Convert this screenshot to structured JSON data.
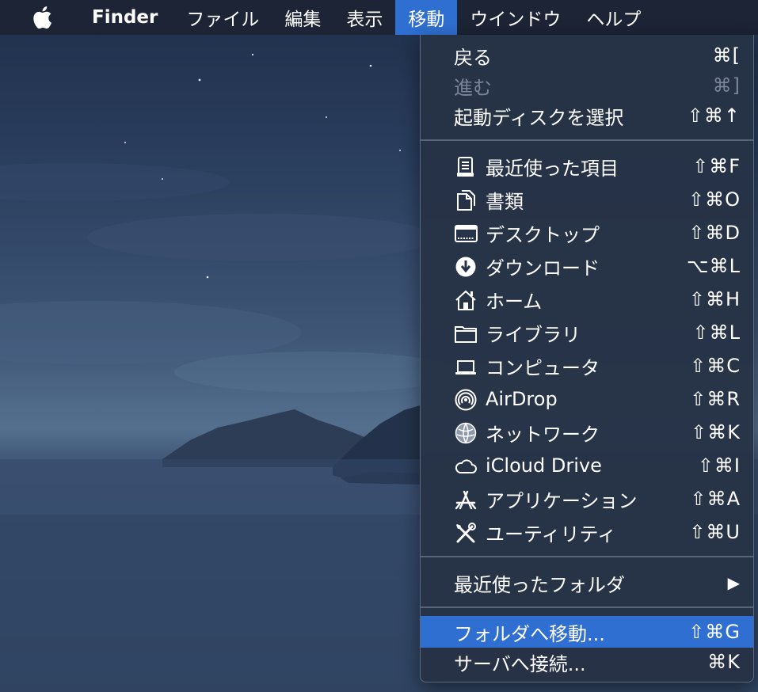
{
  "menubar": {
    "apple_icon": "apple-logo-icon",
    "app_name": "Finder",
    "items": [
      "ファイル",
      "編集",
      "表示",
      "移動",
      "ウインドウ",
      "ヘルプ"
    ],
    "active_item": "移動"
  },
  "go_menu": {
    "back": {
      "label": "戻る",
      "shortcut": "⌘["
    },
    "forward": {
      "label": "進む",
      "shortcut": "⌘]",
      "disabled": true
    },
    "startup_disk": {
      "label": "起動ディスクを選択",
      "shortcut": "⇧⌘↑"
    },
    "locations": [
      {
        "label": "最近使った項目",
        "shortcut": "⇧⌘F",
        "icon": "recents-icon"
      },
      {
        "label": "書類",
        "shortcut": "⇧⌘O",
        "icon": "documents-icon"
      },
      {
        "label": "デスクトップ",
        "shortcut": "⇧⌘D",
        "icon": "desktop-icon"
      },
      {
        "label": "ダウンロード",
        "shortcut": "⌥⌘L",
        "icon": "downloads-icon"
      },
      {
        "label": "ホーム",
        "shortcut": "⇧⌘H",
        "icon": "home-icon"
      },
      {
        "label": "ライブラリ",
        "shortcut": "⇧⌘L",
        "icon": "folder-icon"
      },
      {
        "label": "コンピュータ",
        "shortcut": "⇧⌘C",
        "icon": "computer-icon"
      },
      {
        "label": "AirDrop",
        "shortcut": "⇧⌘R",
        "icon": "airdrop-icon"
      },
      {
        "label": "ネットワーク",
        "shortcut": "⇧⌘K",
        "icon": "network-icon"
      },
      {
        "label": "iCloud Drive",
        "shortcut": "⇧⌘I",
        "icon": "cloud-icon"
      },
      {
        "label": "アプリケーション",
        "shortcut": "⇧⌘A",
        "icon": "applications-icon"
      },
      {
        "label": "ユーティリティ",
        "shortcut": "⇧⌘U",
        "icon": "utilities-icon"
      }
    ],
    "recent_folders": {
      "label": "最近使ったフォルダ",
      "submenu_arrow": "▶"
    },
    "go_to_folder": {
      "label": "フォルダへ移動...",
      "shortcut": "⇧⌘G",
      "selected": true
    },
    "connect_server": {
      "label": "サーバへ接続...",
      "shortcut": "⌘K"
    }
  },
  "colors": {
    "highlight": "#2f6fd1",
    "menu_bg": "#263246",
    "disabled_text": "#7b8598"
  }
}
